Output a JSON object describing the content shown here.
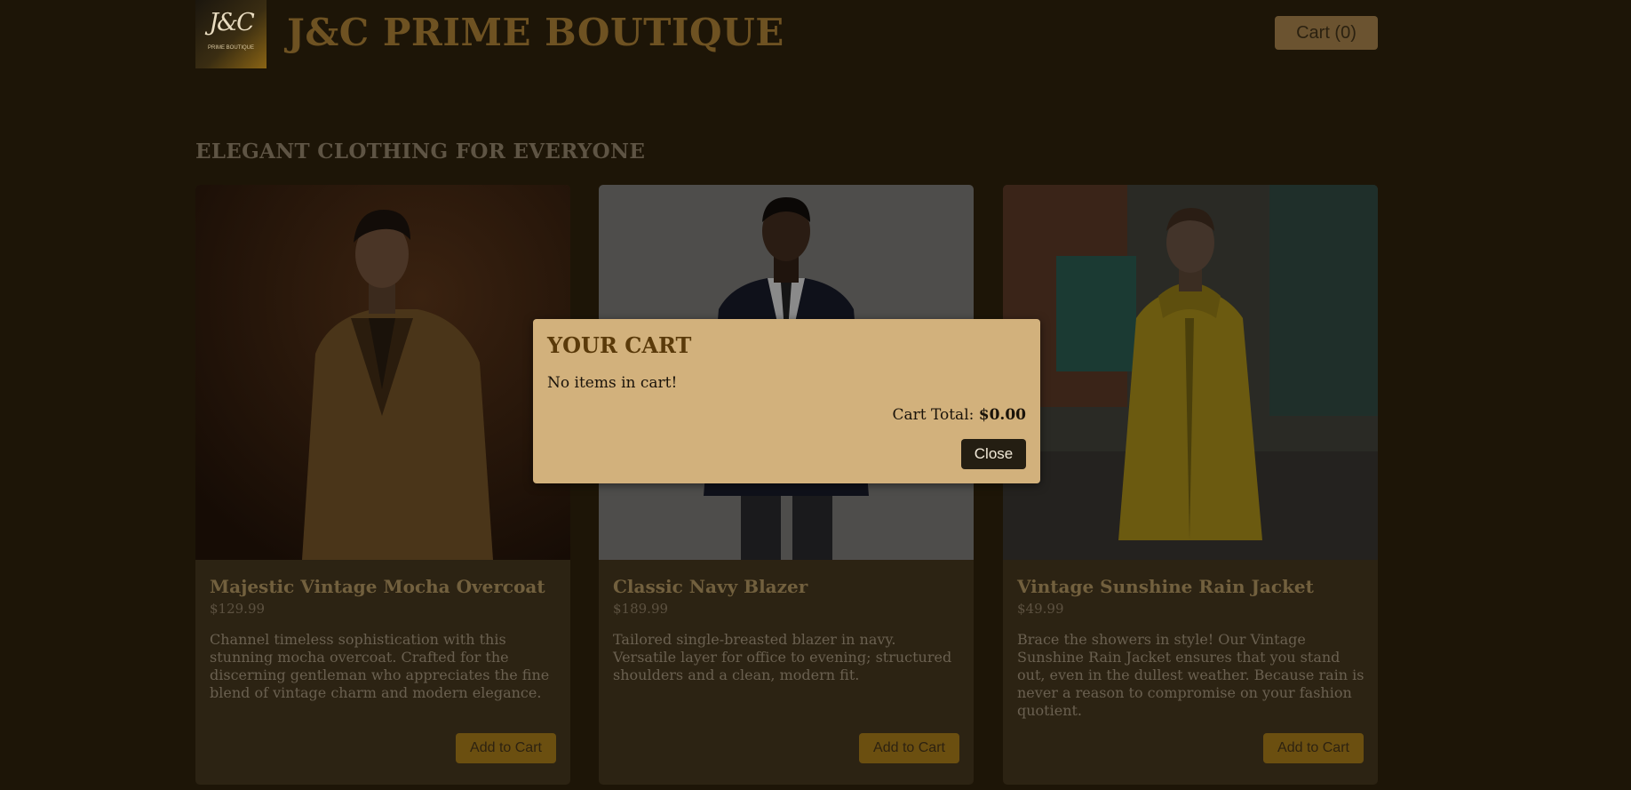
{
  "header": {
    "logo_mark": "J&C",
    "logo_subtitle": "PRIME BOUTIQUE",
    "title": "J&C PRIME BOUTIQUE",
    "cart_button_label": "Cart (0)"
  },
  "main": {
    "section_title": "ELEGANT CLOTHING FOR EVERYONE",
    "products": [
      {
        "name": "Majestic Vintage Mocha Overcoat",
        "price": "$129.99",
        "description": "Channel timeless sophistication with this stunning mocha overcoat. Crafted for the discerning gentleman who appreciates the fine blend of vintage charm and modern elegance.",
        "button_label": "Add to Cart"
      },
      {
        "name": "Classic Navy Blazer",
        "price": "$189.99",
        "description": "Tailored single-breasted blazer in navy. Versatile layer for office to evening; structured shoulders and a clean, modern fit.",
        "button_label": "Add to Cart"
      },
      {
        "name": "Vintage Sunshine Rain Jacket",
        "price": "$49.99",
        "description": "Brace the showers in style! Our Vintage Sunshine Rain Jacket ensures that you stand out, even in the dullest weather. Because rain is never a reason to compromise on your fashion quotient.",
        "button_label": "Add to Cart"
      }
    ]
  },
  "cart_modal": {
    "title": "YOUR CART",
    "empty_message": "No items in cart!",
    "total_label": "Cart Total:",
    "total_value": "$0.00",
    "close_label": "Close"
  },
  "colors": {
    "background": "#1d1507",
    "card": "#2c2313",
    "modal": "#d2b17c",
    "accent": "#6b4f10"
  }
}
